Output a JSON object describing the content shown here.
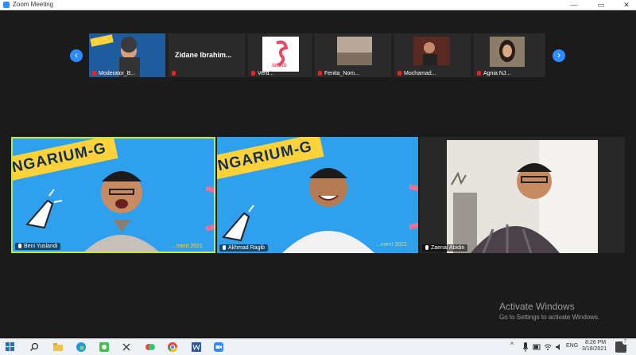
{
  "window": {
    "title": "Zoom Meeting",
    "controls": {
      "minimize": "—",
      "maximize": "▭",
      "close": "✕"
    }
  },
  "gallery": {
    "prev_arrow": "‹",
    "next_arrow": "›",
    "thumbnails": [
      {
        "label": "Moderator_B..."
      },
      {
        "label": "Zidane_Ibrahim...",
        "name_large": "Zidane Ibrahim..."
      },
      {
        "label": "Verd...",
        "logo_text": "SIRAD"
      },
      {
        "label": "Fenita_Nom..."
      },
      {
        "label": "Mochamad..."
      },
      {
        "label": "Agnia NJ..."
      }
    ]
  },
  "main_tiles": [
    {
      "name": "Beni Yuslandi",
      "banner": "NGARIUM-G",
      "footer_text": "...ment 2021"
    },
    {
      "name": "Akhmad Ragib",
      "banner": "NGARIUM-G",
      "footer_text": "...ment 2021"
    },
    {
      "name": "Zaenal Abidin"
    }
  ],
  "watermark": {
    "line1": "Activate Windows",
    "line2": "Go to Settings to activate Windows."
  },
  "taskbar": {
    "lang": "ENG",
    "time": "8:26 PM",
    "date": "3/18/2021",
    "notify": "7"
  },
  "colors": {
    "accent": "#2d8cff",
    "speaker_border": "#c8e640",
    "tile_bg": "#2fa0ee",
    "banner": "#ffd23a"
  }
}
